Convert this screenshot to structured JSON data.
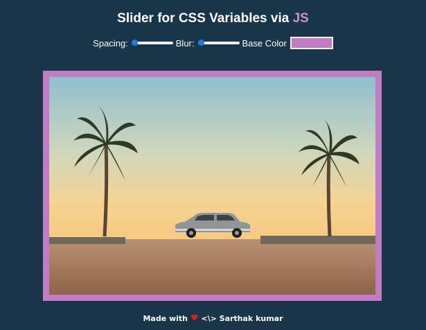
{
  "header": {
    "title_text": "Slider for CSS Variables via ",
    "title_highlight": "JS"
  },
  "controls": {
    "spacing_label": "Spacing:",
    "spacing_value": 0,
    "blur_label": "Blur:",
    "blur_value": 0,
    "base_color_label": "Base Color",
    "base_color_value": "#c17cc3"
  },
  "image": {
    "alt": "car between palm trees at sunset",
    "sky_top_color": "#8fbfcf",
    "sky_bottom_color": "#f8c77e",
    "ground_color": "#a67a5e"
  },
  "footer": {
    "prefix": "Made with",
    "heart": "♥",
    "suffix": "<\\> Sarthak kumar"
  },
  "colors": {
    "background": "#193549",
    "accent": "#d18fd1",
    "frame": "#c17cc3",
    "slider_thumb": "#1f7ae6"
  }
}
